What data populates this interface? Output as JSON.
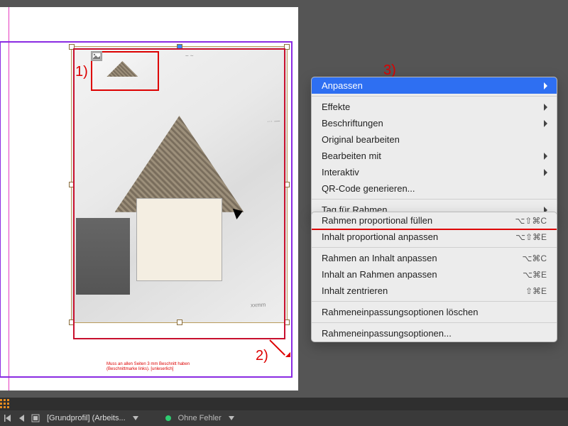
{
  "annotations": {
    "num1": "1)",
    "num2": "2)",
    "num3": "3)"
  },
  "menu_main": {
    "items": [
      {
        "label": "Anpassen",
        "submenu": true,
        "selected": true
      },
      {
        "label": "Effekte",
        "submenu": true
      },
      {
        "label": "Beschriftungen",
        "submenu": true
      },
      {
        "label": "Original bearbeiten"
      },
      {
        "label": "Bearbeiten mit",
        "submenu": true
      },
      {
        "label": "Interaktiv",
        "submenu": true
      },
      {
        "label": "QR-Code generieren..."
      },
      {
        "label": "Tag für Rahmen",
        "submenu": true
      }
    ]
  },
  "menu_fit": {
    "items": [
      {
        "label": "Rahmen proportional füllen",
        "shortcut": "⌥⇧⌘C",
        "boxed": true
      },
      {
        "label": "Inhalt proportional anpassen",
        "shortcut": "⌥⇧⌘E"
      }
    ],
    "items2": [
      {
        "label": "Rahmen an Inhalt anpassen",
        "shortcut": "⌥⌘C"
      },
      {
        "label": "Inhalt an Rahmen anpassen",
        "shortcut": "⌥⌘E"
      },
      {
        "label": "Inhalt zentrieren",
        "shortcut": "⇧⌘E"
      }
    ],
    "items3": [
      {
        "label": "Rahmeneinpassungsoptionen löschen"
      }
    ],
    "items4": [
      {
        "label": "Rahmeneinpassungsoptionen..."
      }
    ]
  },
  "statusbar": {
    "document": "[Grundprofil] (Arbeits...",
    "errors": "Ohne Fehler"
  },
  "note_text": "Muss an allen Seiten 3 mm Beschnitt haben (Beschnittmarke links). [unleserlich]"
}
